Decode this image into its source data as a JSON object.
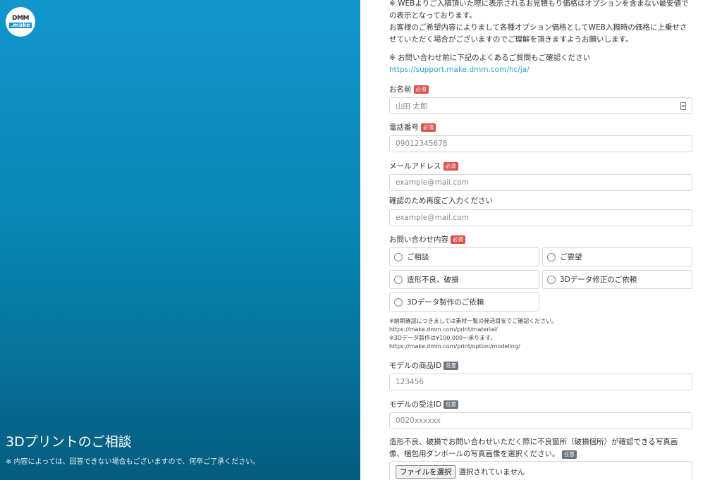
{
  "brand": {
    "logo_top": "DMM",
    "logo_bottom": ".make"
  },
  "hero": {
    "title": "3Dプリントのご相談",
    "note": "※ 内容によっては、回答できない場合もございますので、何卒ご了承ください。"
  },
  "intro": {
    "notice_1": "※ WEBよりご入稿頂いた際に表示されるお見積もり価格はオプションを含まない最安値での表示となっております。",
    "notice_2": "お客様のご希望内容によりまして各種オプション価格としてWEB入稿時の価格に上乗せさせていただく場合がございますのでご理解を頂きますようお願いします。",
    "faq_text": "※ お問い合わせ前に下記のよくあるご質問もご確認ください",
    "faq_link": "https://support.make.dmm.com/hc/ja/"
  },
  "badges": {
    "required": "必須",
    "optional": "任意"
  },
  "form": {
    "name": {
      "label": "お名前",
      "placeholder": "山田 太郎"
    },
    "phone": {
      "label": "電話番号",
      "placeholder": "09012345678"
    },
    "email": {
      "label": "メールアドレス",
      "placeholder": "example@mail.com"
    },
    "email_confirm": {
      "label": "確認のため再度ご入力ください",
      "placeholder": "example@mail.com"
    },
    "inquiry": {
      "label": "お問い合わせ内容",
      "options": [
        "ご相談",
        "ご要望",
        "造形不良、破損",
        "3Dデータ修正のご依頼",
        "3Dデータ製作のご依頼"
      ]
    },
    "notes": {
      "line1": "※納期確認につきましては素材一覧の発送目安でご確認ください。",
      "link1": "https://make.dmm.com/print/material/",
      "line2": "※3Dデータ製作は¥100,000〜承ります。",
      "link2": "https://make.dmm.com/print/option/modeling/"
    },
    "product_id": {
      "label": "モデルの商品ID",
      "placeholder": "123456"
    },
    "order_id": {
      "label": "モデルの受注ID",
      "placeholder": "0020xxxxxx"
    },
    "photo": {
      "label": "造形不良、破損でお問い合わせいただく際に不良箇所（破損個所）が確認できる写真画像、梱包用ダンボールの写真画像を選択ください。",
      "button": "ファイルを選択",
      "status": "選択されていません"
    }
  }
}
